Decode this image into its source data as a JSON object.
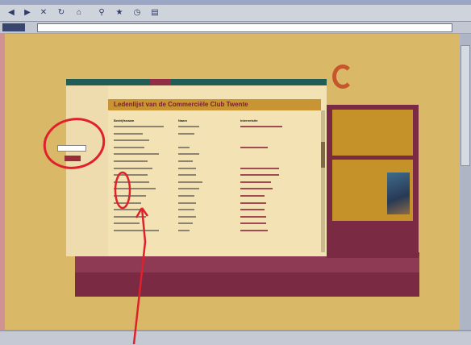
{
  "browser": {
    "url": "",
    "toolbar_icons": [
      "back-icon",
      "forward-icon",
      "stop-icon",
      "refresh-icon",
      "home-icon",
      "search-icon",
      "favorites-icon",
      "history-icon",
      "print-icon"
    ],
    "status_text": ""
  },
  "site": {
    "logo_text": "",
    "nav_tabs": [
      "",
      "",
      "",
      "",
      "",
      ""
    ],
    "login": {
      "title": "",
      "field_value": "",
      "button_label": ""
    },
    "heading": "Ledenlijst van de Commerciële Club Twente",
    "columns": [
      "Bedrijfsnaam",
      "Naam",
      "Internetsite"
    ],
    "side_menu": [
      "",
      "",
      "",
      ""
    ],
    "side_box_title": ""
  },
  "colors": {
    "accent": "#7b2a44",
    "gold": "#c99433",
    "annotation": "#e0202a"
  }
}
